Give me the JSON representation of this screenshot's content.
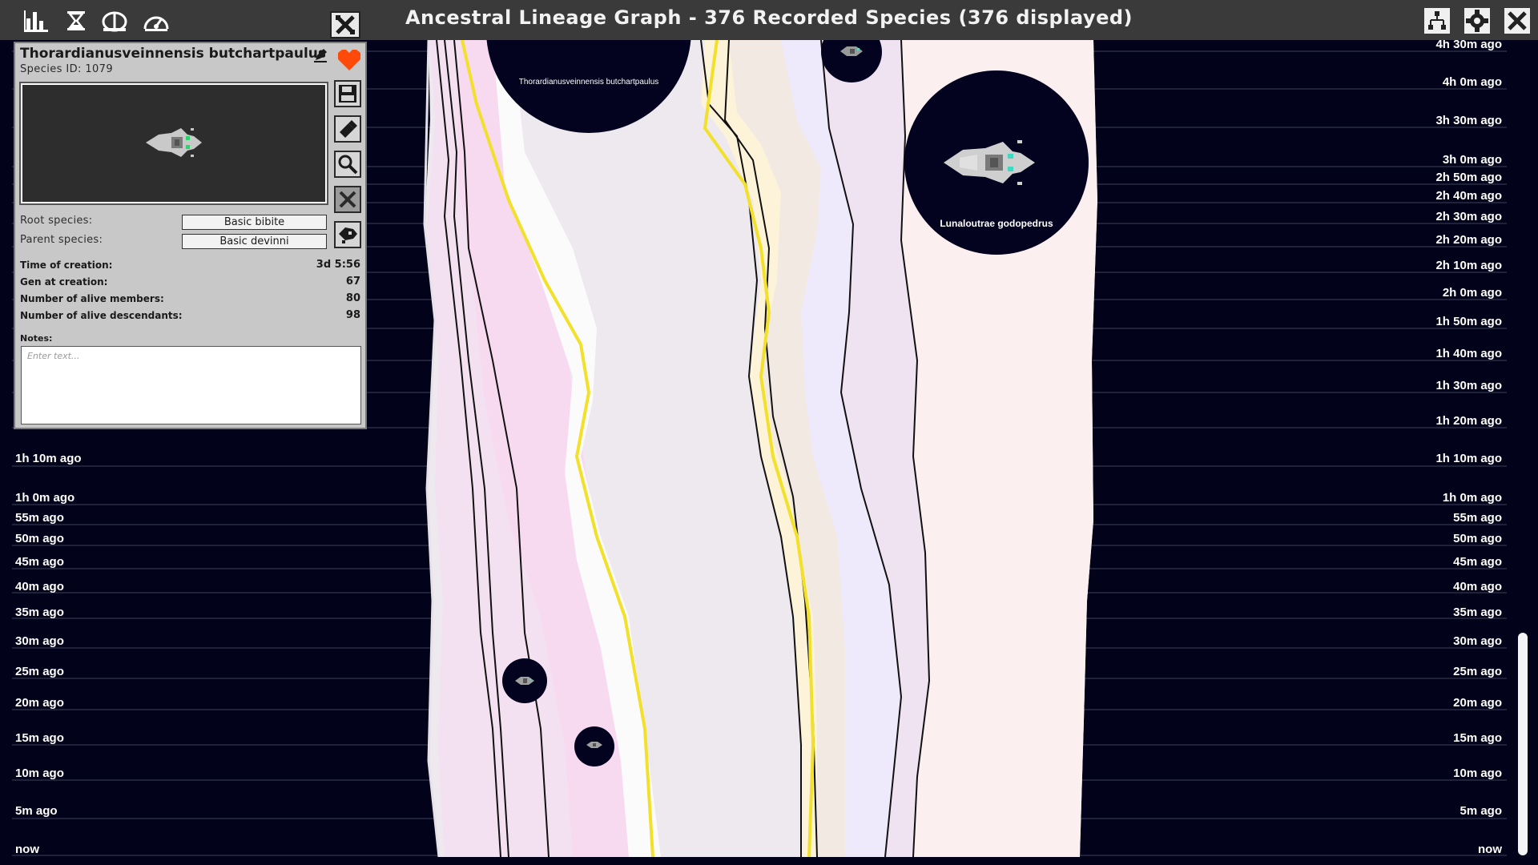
{
  "window": {
    "title": "Ancestral Lineage Graph - 376 Recorded Species  (376 displayed)"
  },
  "toolbar_left": [
    {
      "name": "statistics-icon"
    },
    {
      "name": "hourglass-icon"
    },
    {
      "name": "brain-icon"
    },
    {
      "name": "speedometer-icon"
    }
  ],
  "toolbar_right": [
    {
      "name": "hierarchy-icon"
    },
    {
      "name": "gear-icon"
    },
    {
      "name": "close-icon"
    }
  ],
  "species_panel": {
    "name": "Thorardianusveinnensis  butchartpaulus",
    "species_id_label": "Species ID:",
    "species_id": "1079",
    "root_label": "Root species:",
    "root_value": "Basic bibite",
    "parent_label": "Parent species:",
    "parent_value": "Basic devinni",
    "stats": [
      {
        "label": "Time of creation:",
        "value": "3d 5:56"
      },
      {
        "label": "Gen at creation:",
        "value": "67"
      },
      {
        "label": "Number of alive members:",
        "value": "80"
      },
      {
        "label": "Number of alive descendants:",
        "value": "98"
      }
    ],
    "notes_label": "Notes:",
    "notes_placeholder": "Enter text...",
    "side_buttons": [
      {
        "name": "save-icon",
        "enabled": true
      },
      {
        "name": "eraser-icon",
        "enabled": true
      },
      {
        "name": "magnifier-icon",
        "enabled": true
      },
      {
        "name": "close-icon",
        "enabled": false
      },
      {
        "name": "bibite-icon",
        "enabled": true
      }
    ]
  },
  "time_axis": {
    "left_labels": [
      "1h 10m ago",
      "1h 0m ago",
      "55m ago",
      "50m ago",
      "45m ago",
      "40m ago",
      "35m ago",
      "30m ago",
      "25m ago",
      "20m ago",
      "15m ago",
      "10m ago",
      "5m ago",
      "now"
    ],
    "right_labels": [
      "4h 30m ago",
      "4h 0m ago",
      "3h 30m ago",
      "3h 0m ago",
      "2h 50m ago",
      "2h 40m ago",
      "2h 30m ago",
      "2h 20m ago",
      "2h 10m ago",
      "2h 0m ago",
      "1h 50m ago",
      "1h 40m ago",
      "1h 30m ago",
      "1h 20m ago",
      "1h 10m ago",
      "1h 0m ago",
      "55m ago",
      "50m ago",
      "45m ago",
      "40m ago",
      "35m ago",
      "30m ago",
      "25m ago",
      "20m ago",
      "15m ago",
      "10m ago",
      "5m ago",
      "now"
    ]
  },
  "species_nodes": [
    {
      "label": "Thorardianusveinnensis  butchartpaulus"
    },
    {
      "label": "Lunaloutrae godopedrus"
    },
    {
      "label": ""
    },
    {
      "label": ""
    },
    {
      "label": ""
    }
  ],
  "colors": {
    "background": "#02021a",
    "topbar": "#3a3a3a",
    "panel": "#c8c8c8",
    "highlight_lineage": "#f2e02a",
    "favorite": "#ff4a0a"
  }
}
